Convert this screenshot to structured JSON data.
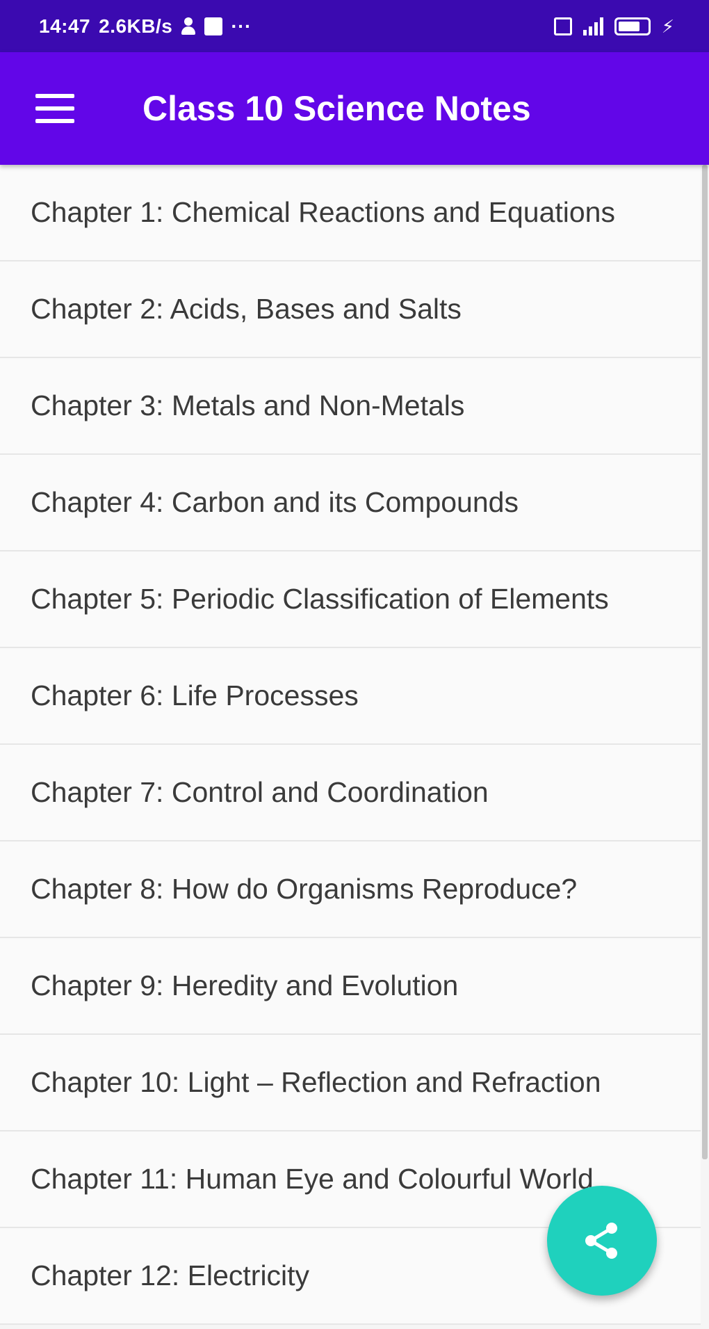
{
  "status_bar": {
    "time": "14:47",
    "speed": "2.6KB/s",
    "more": "···",
    "bolt": "⚡"
  },
  "app_bar": {
    "title": "Class 10 Science Notes"
  },
  "chapters": [
    "Chapter 1: Chemical Reactions and Equations",
    "Chapter 2: Acids, Bases and Salts",
    "Chapter 3: Metals and Non-Metals",
    "Chapter 4: Carbon and its Compounds",
    "Chapter 5: Periodic Classification of Elements",
    "Chapter 6: Life Processes",
    "Chapter 7: Control and Coordination",
    "Chapter 8: How do Organisms Reproduce?",
    "Chapter 9: Heredity and Evolution",
    "Chapter 10: Light – Reflection and Refraction",
    "Chapter 11: Human Eye and Colourful World",
    "Chapter 12: Electricity"
  ],
  "fab": {
    "icon": "share-icon"
  },
  "colors": {
    "status_bar": "#3b0ab0",
    "app_bar": "#6206e8",
    "fab": "#1fd1bd",
    "list_background": "#fafafa",
    "text": "#3a3a3a"
  }
}
